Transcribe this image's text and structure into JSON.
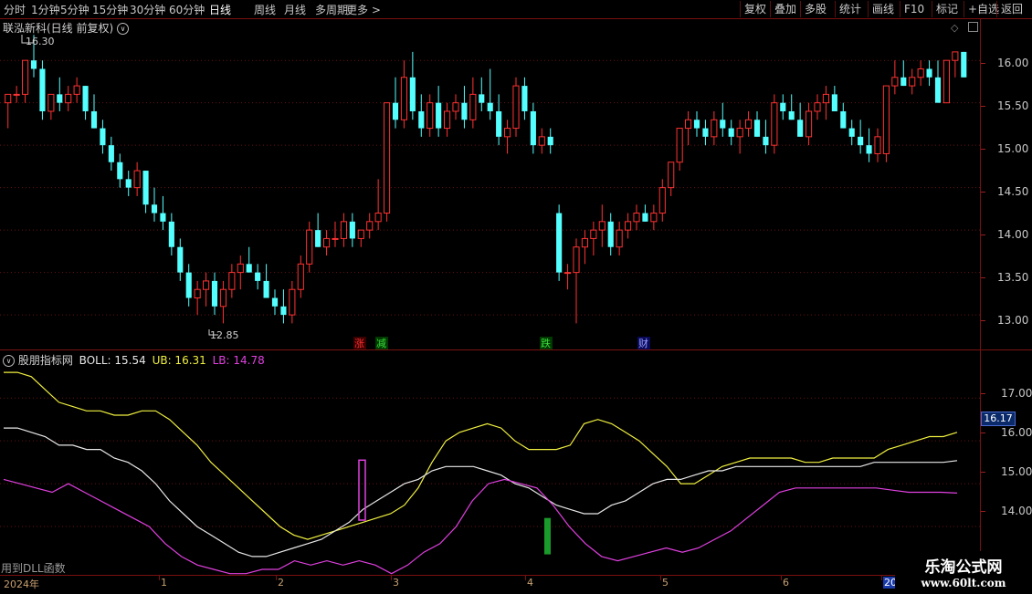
{
  "toolbar": {
    "periods": [
      "分时",
      "1分钟",
      "5分钟",
      "15分钟",
      "30分钟",
      "60分钟",
      "日线",
      "周线",
      "月线",
      "多周期",
      "更多 >"
    ],
    "active_period": "日线",
    "right_buttons": [
      "复权",
      "叠加",
      "多股",
      "统计",
      "画线",
      "F10",
      "标记",
      "+自选",
      "返回"
    ]
  },
  "main_chart": {
    "title": "联泓新科(日线 前复权)",
    "high_label": "16.30",
    "low_label": "12.85",
    "y_ticks": [
      "16.00",
      "15.50",
      "15.00",
      "14.50",
      "14.00",
      "13.50",
      "13.00"
    ],
    "markers": [
      {
        "text": "涨",
        "color": "#ff3030"
      },
      {
        "text": "减",
        "color": "#3cdc3c"
      },
      {
        "text": "跌",
        "color": "#3cdc3c"
      },
      {
        "text": "财",
        "color": "#9aa0ff"
      }
    ]
  },
  "indicator": {
    "name": "股朋指标网",
    "boll_label": "BOLL: 15.54",
    "ub_label": "UB: 16.31",
    "lb_label": "LB: 14.78",
    "y_ticks": [
      "17.00",
      "16.00",
      "15.00",
      "14.00"
    ],
    "current_value_tag": "16.17",
    "footnote": "用到DLL函数"
  },
  "x_axis": {
    "labels": [
      "2024年",
      "1",
      "2",
      "3",
      "4",
      "5",
      "6",
      "20"
    ]
  },
  "watermark": {
    "name": "乐淘公式网",
    "url": "www.60lt.com"
  },
  "chart_data": {
    "type": "candlestick",
    "ylim": [
      12.7,
      16.4
    ],
    "indicator_ylim": [
      13.0,
      17.9
    ],
    "candles": [
      [
        15.5,
        15.6,
        15.2,
        15.6
      ],
      [
        15.6,
        15.7,
        15.5,
        15.6
      ],
      [
        15.6,
        16.0,
        15.5,
        16.0
      ],
      [
        16.0,
        16.3,
        15.8,
        15.9
      ],
      [
        15.9,
        16.0,
        15.3,
        15.4
      ],
      [
        15.4,
        15.6,
        15.3,
        15.6
      ],
      [
        15.6,
        15.8,
        15.4,
        15.5
      ],
      [
        15.5,
        15.7,
        15.4,
        15.6
      ],
      [
        15.6,
        15.8,
        15.5,
        15.7
      ],
      [
        15.7,
        15.7,
        15.3,
        15.4
      ],
      [
        15.4,
        15.6,
        15.2,
        15.2
      ],
      [
        15.2,
        15.3,
        14.9,
        15.0
      ],
      [
        15.0,
        15.1,
        14.7,
        14.8
      ],
      [
        14.8,
        14.9,
        14.5,
        14.6
      ],
      [
        14.6,
        14.7,
        14.4,
        14.5
      ],
      [
        14.5,
        14.8,
        14.4,
        14.7
      ],
      [
        14.7,
        14.7,
        14.2,
        14.3
      ],
      [
        14.3,
        14.5,
        14.1,
        14.2
      ],
      [
        14.2,
        14.4,
        14.0,
        14.1
      ],
      [
        14.1,
        14.2,
        13.7,
        13.8
      ],
      [
        13.8,
        13.9,
        13.4,
        13.5
      ],
      [
        13.5,
        13.6,
        13.1,
        13.2
      ],
      [
        13.2,
        13.4,
        13.0,
        13.3
      ],
      [
        13.3,
        13.5,
        13.1,
        13.4
      ],
      [
        13.4,
        13.5,
        13.0,
        13.1
      ],
      [
        13.1,
        13.4,
        12.9,
        13.3
      ],
      [
        13.3,
        13.6,
        13.2,
        13.5
      ],
      [
        13.5,
        13.7,
        13.3,
        13.6
      ],
      [
        13.6,
        13.8,
        13.5,
        13.5
      ],
      [
        13.5,
        13.6,
        13.3,
        13.4
      ],
      [
        13.4,
        13.6,
        13.2,
        13.2
      ],
      [
        13.2,
        13.3,
        13.0,
        13.1
      ],
      [
        13.1,
        13.3,
        12.9,
        13.0
      ],
      [
        13.0,
        13.4,
        12.9,
        13.3
      ],
      [
        13.3,
        13.7,
        13.2,
        13.6
      ],
      [
        13.6,
        14.1,
        13.5,
        14.0
      ],
      [
        14.0,
        14.2,
        13.8,
        13.8
      ],
      [
        13.8,
        14.0,
        13.7,
        13.9
      ],
      [
        13.9,
        14.1,
        13.8,
        13.9
      ],
      [
        13.9,
        14.2,
        13.8,
        14.1
      ],
      [
        14.1,
        14.2,
        13.8,
        13.9
      ],
      [
        13.9,
        14.0,
        13.8,
        14.0
      ],
      [
        14.0,
        14.2,
        13.9,
        14.1
      ],
      [
        14.1,
        14.6,
        14.0,
        14.2
      ],
      [
        14.2,
        15.5,
        14.1,
        15.5
      ],
      [
        15.5,
        15.8,
        15.2,
        15.3
      ],
      [
        15.3,
        16.0,
        15.2,
        15.8
      ],
      [
        15.8,
        16.1,
        15.3,
        15.4
      ],
      [
        15.4,
        15.6,
        15.1,
        15.2
      ],
      [
        15.2,
        15.6,
        15.1,
        15.5
      ],
      [
        15.5,
        15.7,
        15.1,
        15.2
      ],
      [
        15.2,
        15.5,
        15.1,
        15.4
      ],
      [
        15.4,
        15.6,
        15.3,
        15.5
      ],
      [
        15.5,
        15.7,
        15.2,
        15.3
      ],
      [
        15.3,
        15.8,
        15.2,
        15.6
      ],
      [
        15.6,
        15.8,
        15.4,
        15.5
      ],
      [
        15.5,
        15.9,
        15.3,
        15.4
      ],
      [
        15.4,
        15.6,
        15.0,
        15.1
      ],
      [
        15.1,
        15.3,
        14.9,
        15.2
      ],
      [
        15.2,
        15.8,
        15.1,
        15.7
      ],
      [
        15.7,
        15.8,
        15.3,
        15.4
      ],
      [
        15.4,
        15.5,
        14.9,
        15.0
      ],
      [
        15.0,
        15.2,
        14.9,
        15.1
      ],
      [
        15.1,
        15.2,
        14.9,
        15.0
      ],
      [
        14.2,
        14.3,
        13.4,
        13.5
      ],
      [
        13.5,
        13.6,
        13.3,
        13.5
      ],
      [
        13.5,
        13.9,
        12.9,
        13.8
      ],
      [
        13.8,
        14.0,
        13.6,
        13.9
      ],
      [
        13.9,
        14.1,
        13.7,
        14.0
      ],
      [
        14.0,
        14.3,
        13.8,
        14.1
      ],
      [
        14.1,
        14.2,
        13.7,
        13.8
      ],
      [
        13.8,
        14.1,
        13.7,
        14.0
      ],
      [
        14.0,
        14.2,
        13.9,
        14.1
      ],
      [
        14.1,
        14.3,
        14.0,
        14.2
      ],
      [
        14.2,
        14.3,
        14.1,
        14.1
      ],
      [
        14.1,
        14.3,
        14.0,
        14.2
      ],
      [
        14.2,
        14.6,
        14.1,
        14.5
      ],
      [
        14.5,
        14.8,
        14.4,
        14.8
      ],
      [
        14.8,
        15.2,
        14.7,
        15.2
      ],
      [
        15.2,
        15.4,
        15.0,
        15.3
      ],
      [
        15.3,
        15.4,
        15.1,
        15.2
      ],
      [
        15.2,
        15.3,
        15.0,
        15.1
      ],
      [
        15.1,
        15.4,
        15.0,
        15.3
      ],
      [
        15.3,
        15.5,
        15.1,
        15.2
      ],
      [
        15.2,
        15.3,
        15.0,
        15.1
      ],
      [
        15.1,
        15.3,
        14.9,
        15.2
      ],
      [
        15.2,
        15.4,
        15.1,
        15.3
      ],
      [
        15.3,
        15.4,
        15.1,
        15.1
      ],
      [
        15.1,
        15.3,
        14.9,
        15.0
      ],
      [
        15.0,
        15.6,
        14.9,
        15.5
      ],
      [
        15.5,
        15.6,
        15.3,
        15.4
      ],
      [
        15.4,
        15.6,
        15.3,
        15.3
      ],
      [
        15.3,
        15.5,
        15.1,
        15.1
      ],
      [
        15.1,
        15.5,
        15.0,
        15.4
      ],
      [
        15.4,
        15.6,
        15.3,
        15.5
      ],
      [
        15.5,
        15.7,
        15.3,
        15.6
      ],
      [
        15.6,
        15.7,
        15.4,
        15.4
      ],
      [
        15.4,
        15.5,
        15.2,
        15.2
      ],
      [
        15.2,
        15.3,
        15.0,
        15.1
      ],
      [
        15.1,
        15.3,
        14.9,
        15.0
      ],
      [
        15.0,
        15.2,
        14.8,
        14.9
      ],
      [
        14.9,
        15.2,
        14.8,
        15.1
      ],
      [
        14.9,
        15.7,
        14.8,
        15.7
      ],
      [
        15.7,
        16.0,
        15.6,
        15.8
      ],
      [
        15.8,
        16.0,
        15.7,
        15.7
      ],
      [
        15.7,
        15.9,
        15.6,
        15.8
      ],
      [
        15.8,
        16.0,
        15.7,
        15.9
      ],
      [
        15.9,
        16.0,
        15.7,
        15.8
      ],
      [
        15.8,
        16.0,
        15.5,
        15.5
      ],
      [
        15.5,
        16.0,
        15.5,
        16.0
      ],
      [
        16.0,
        16.1,
        15.8,
        16.1
      ],
      [
        16.1,
        16.1,
        15.8,
        15.8
      ]
    ],
    "boll": {
      "upper": [
        17.6,
        17.6,
        17.5,
        17.2,
        16.9,
        16.8,
        16.7,
        16.7,
        16.6,
        16.6,
        16.7,
        16.7,
        16.5,
        16.2,
        15.9,
        15.5,
        15.2,
        14.9,
        14.6,
        14.3,
        14.0,
        13.8,
        13.7,
        13.8,
        13.9,
        14.0,
        14.1,
        14.2,
        14.3,
        14.5,
        14.9,
        15.5,
        16.0,
        16.2,
        16.3,
        16.4,
        16.3,
        16.0,
        15.8,
        15.8,
        15.8,
        15.9,
        16.4,
        16.5,
        16.4,
        16.2,
        16.0,
        15.7,
        15.4,
        15.0,
        15.0,
        15.2,
        15.4,
        15.5,
        15.6,
        15.6,
        15.6,
        15.6,
        15.5,
        15.5,
        15.6,
        15.6,
        15.6,
        15.6,
        15.8,
        15.9,
        16.0,
        16.1,
        16.1,
        16.2
      ],
      "mid": [
        16.3,
        16.3,
        16.2,
        16.1,
        15.9,
        15.9,
        15.8,
        15.8,
        15.6,
        15.5,
        15.3,
        15.0,
        14.6,
        14.3,
        14.0,
        13.8,
        13.6,
        13.4,
        13.3,
        13.3,
        13.4,
        13.5,
        13.6,
        13.7,
        13.9,
        14.1,
        14.4,
        14.6,
        14.8,
        15.0,
        15.1,
        15.3,
        15.4,
        15.4,
        15.4,
        15.3,
        15.2,
        15.0,
        14.9,
        14.7,
        14.5,
        14.4,
        14.3,
        14.3,
        14.5,
        14.6,
        14.8,
        15.0,
        15.1,
        15.1,
        15.2,
        15.3,
        15.3,
        15.4,
        15.4,
        15.4,
        15.4,
        15.4,
        15.4,
        15.4,
        15.4,
        15.4,
        15.4,
        15.5,
        15.5,
        15.5,
        15.5,
        15.5,
        15.5,
        15.54
      ],
      "lower": [
        15.1,
        15.0,
        14.9,
        14.8,
        15.0,
        14.8,
        14.6,
        14.4,
        14.2,
        14.0,
        13.6,
        13.3,
        13.1,
        13.0,
        12.9,
        12.9,
        13.0,
        13.0,
        13.2,
        13.1,
        13.2,
        13.1,
        13.2,
        13.1,
        12.9,
        13.1,
        13.4,
        13.6,
        14.0,
        14.6,
        15.0,
        15.1,
        15.0,
        14.9,
        14.5,
        14.0,
        13.6,
        13.3,
        13.2,
        13.3,
        13.4,
        13.5,
        13.4,
        13.5,
        13.7,
        13.9,
        14.2,
        14.5,
        14.8,
        14.9,
        14.9,
        14.9,
        14.9,
        14.9,
        14.9,
        14.85,
        14.8,
        14.8,
        14.8,
        14.78
      ]
    }
  }
}
